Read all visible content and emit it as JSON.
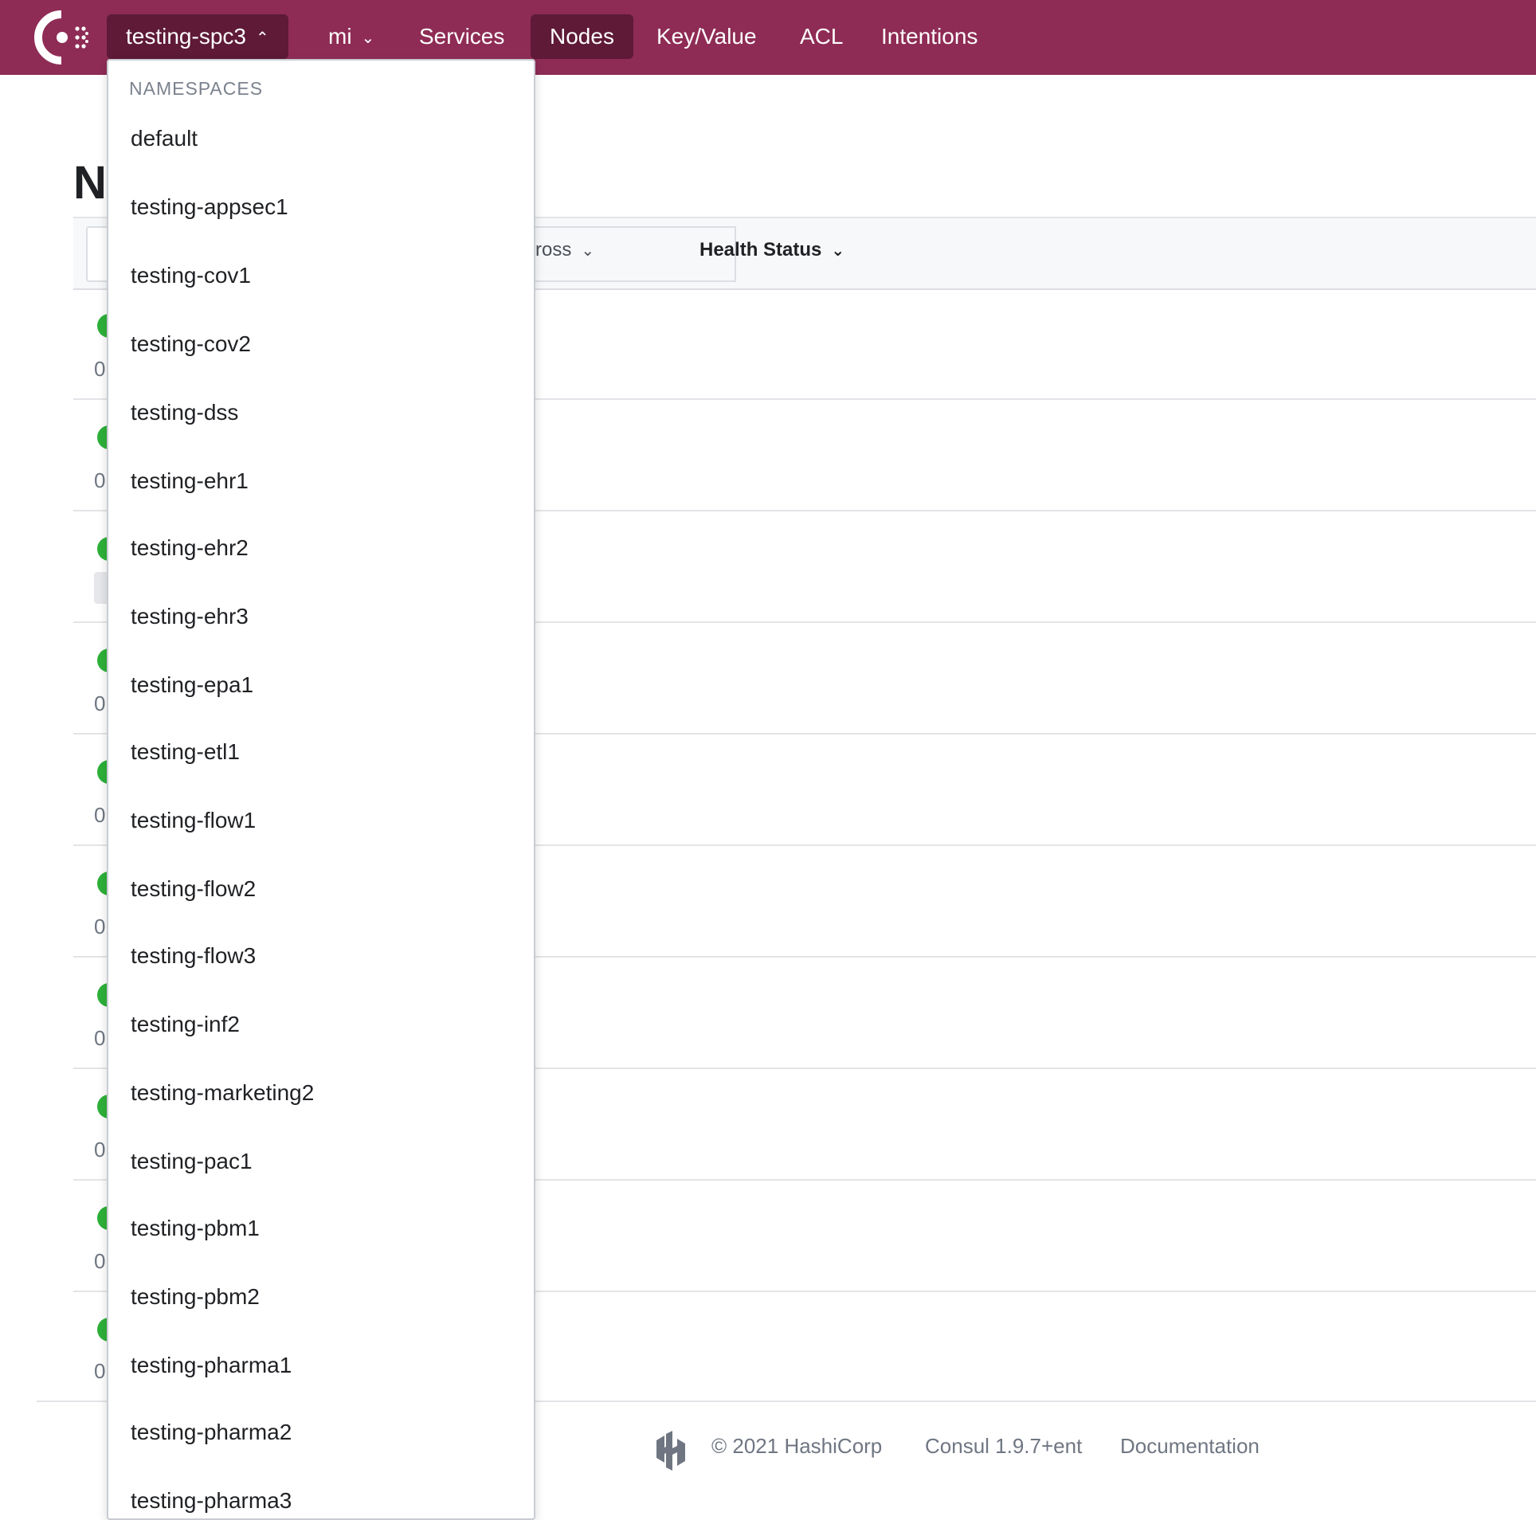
{
  "nav": {
    "datacenter": "testing-spc3",
    "namespace": "mi",
    "items": [
      "Services",
      "Nodes",
      "Key/Value",
      "ACL",
      "Intentions"
    ],
    "active": "Nodes"
  },
  "page": {
    "title_visible": "N",
    "across_label": "cross",
    "health_status_label": "Health Status",
    "row_zero": "0"
  },
  "dropdown": {
    "header": "NAMESPACES",
    "items": [
      "default",
      "testing-appsec1",
      "testing-cov1",
      "testing-cov2",
      "testing-dss",
      "testing-ehr1",
      "testing-ehr2",
      "testing-ehr3",
      "testing-epa1",
      "testing-etl1",
      "testing-flow1",
      "testing-flow2",
      "testing-flow3",
      "testing-inf2",
      "testing-marketing2",
      "testing-pac1",
      "testing-pbm1",
      "testing-pbm2",
      "testing-pharma1",
      "testing-pharma2",
      "testing-pharma3"
    ]
  },
  "footer": {
    "copyright": "© 2021 HashiCorp",
    "version": "Consul 1.9.7+ent",
    "docs": "Documentation"
  },
  "colors": {
    "topbar": "#8e2c55",
    "active_nav": "#5e1a37",
    "healthy": "#2eb039"
  }
}
